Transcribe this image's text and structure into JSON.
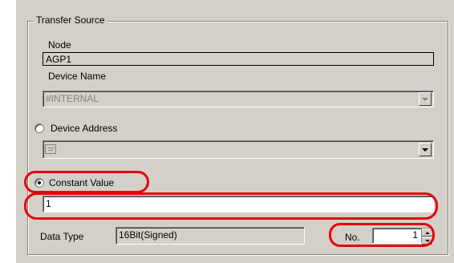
{
  "group": {
    "title": "Transfer Source"
  },
  "node": {
    "label": "Node",
    "value": "AGP1"
  },
  "device_name": {
    "label": "Device Name",
    "value": "#INTERNAL"
  },
  "device_address": {
    "label": "Device Address",
    "value": ""
  },
  "constant_value": {
    "label": "Constant Value",
    "value": "1"
  },
  "data_type": {
    "label": "Data Type",
    "value": "16Bit(Signed)"
  },
  "number": {
    "label": "No.",
    "value": "1"
  },
  "colors": {
    "highlight": "#e8000b",
    "dialog_bg": "#d4d0c8"
  }
}
